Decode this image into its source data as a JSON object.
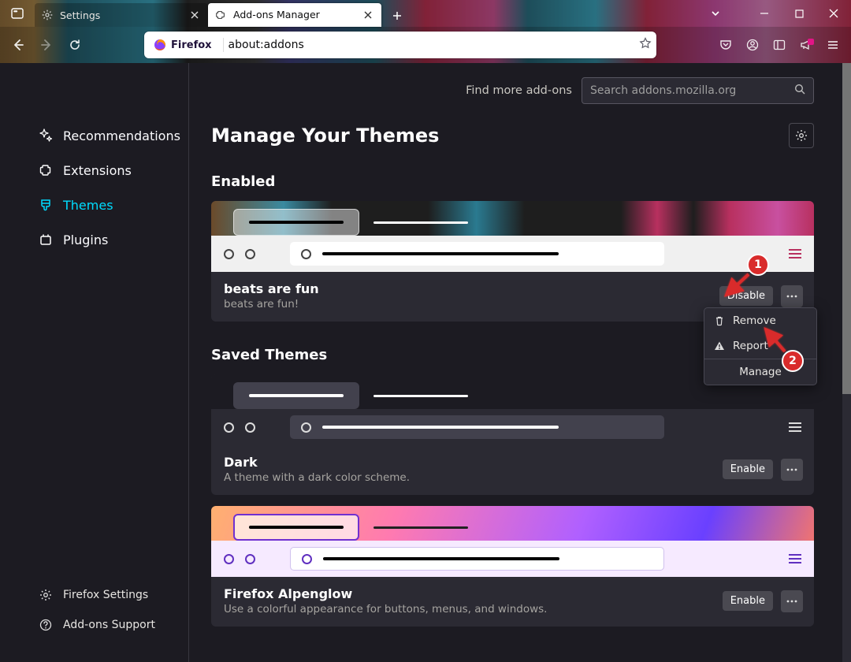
{
  "tabs": [
    {
      "label": "Settings"
    },
    {
      "label": "Add-ons Manager"
    }
  ],
  "urlbar": {
    "identity": "Firefox",
    "url": "about:addons"
  },
  "sidebar": {
    "items": [
      {
        "label": "Recommendations"
      },
      {
        "label": "Extensions"
      },
      {
        "label": "Themes"
      },
      {
        "label": "Plugins"
      }
    ],
    "bottom": [
      {
        "label": "Firefox Settings"
      },
      {
        "label": "Add-ons Support"
      }
    ]
  },
  "findmore": {
    "label": "Find more add-ons",
    "placeholder": "Search addons.mozilla.org"
  },
  "page": {
    "title": "Manage Your Themes"
  },
  "sections": {
    "enabled": "Enabled",
    "saved": "Saved Themes"
  },
  "themes": {
    "enabled": {
      "name": "beats are fun",
      "desc": "beats are fun!",
      "action": "Disable"
    },
    "dark": {
      "name": "Dark",
      "desc": "A theme with a dark color scheme.",
      "action": "Enable"
    },
    "alpenglow": {
      "name": "Firefox Alpenglow",
      "desc": "Use a colorful appearance for buttons, menus, and windows.",
      "action": "Enable"
    }
  },
  "context_menu": {
    "remove": "Remove",
    "report": "Report",
    "manage": "Manage"
  },
  "annotations": {
    "one": "1",
    "two": "2"
  }
}
